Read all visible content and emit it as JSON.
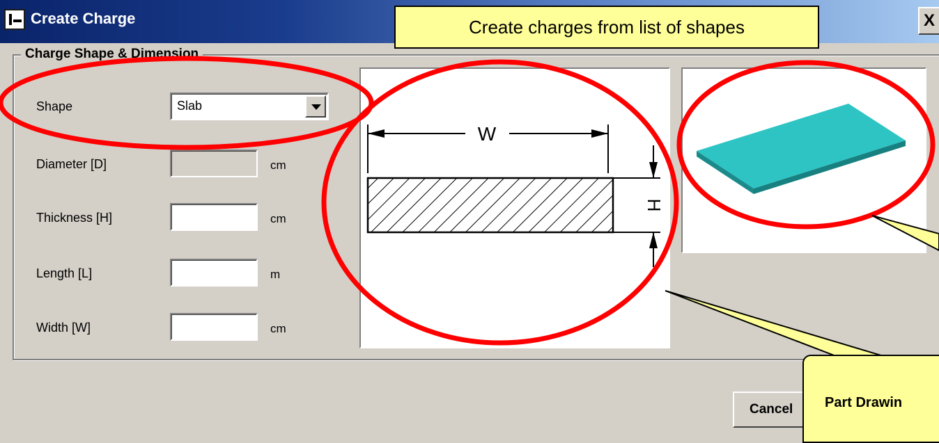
{
  "window": {
    "title": "Create Charge",
    "close_label": "X",
    "icon": "app-icon"
  },
  "group": {
    "legend": "Charge Shape & Dimension"
  },
  "fields": {
    "shape_label": "Shape",
    "shape_value": "Slab",
    "diameter_label": "Diameter [D]",
    "diameter_unit": "cm",
    "thickness_label": "Thickness [H]",
    "thickness_unit": "cm",
    "length_label": "Length [L]",
    "length_unit": "m",
    "width_label": "Width [W]",
    "width_unit": "cm"
  },
  "drawing": {
    "width_dim": "W",
    "height_dim": "H"
  },
  "buttons": {
    "cancel": "Cancel"
  },
  "annotations": {
    "top_callout": "Create charges from list of shapes",
    "bottom_callout": "Part Drawin",
    "highlight_color": "#ff0000",
    "callout_color": "#ffff99",
    "slab_color": "#1fa8a8"
  }
}
